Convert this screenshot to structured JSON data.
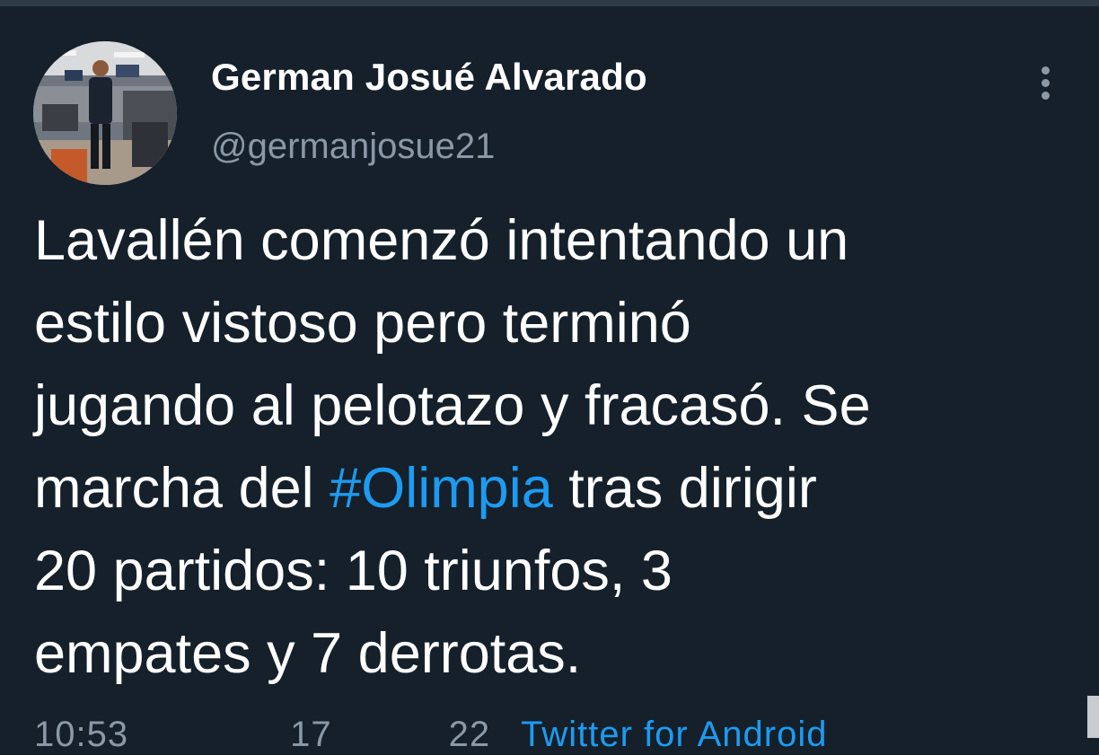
{
  "tweet": {
    "author": {
      "display_name": "German Josué Alvarado",
      "handle": "@germanjosue21"
    },
    "text": {
      "lines": [
        "Lavallén comenzó intentando un",
        "estilo vistoso pero terminó",
        "jugando al pelotazo y fracasó. Se"
      ],
      "line4_before": "marcha del ",
      "hashtag": "#Olimpia",
      "line4_after": " tras dirigir",
      "line5": "20 partidos: 10 triunfos, 3",
      "line6": "empates y 7 derrotas."
    },
    "meta": {
      "time": "10:53",
      "date": "17",
      "year": "22",
      "source": "Twitter for Android"
    },
    "more_icon": "more-vertical-icon"
  },
  "colors": {
    "background": "#15202b",
    "text": "#ffffff",
    "secondary_text": "#8b98a5",
    "link": "#1d9bf0"
  }
}
